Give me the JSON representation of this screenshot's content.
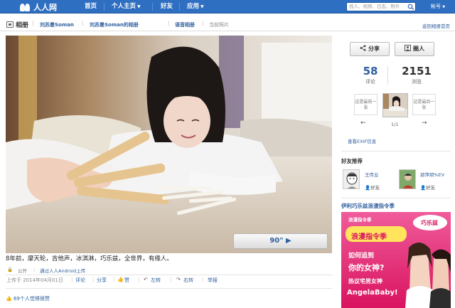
{
  "nav": {
    "logo": "人人网",
    "items": [
      {
        "label": "首页",
        "caret": false
      },
      {
        "label": "个人主页",
        "caret": true
      },
      {
        "label": "好友",
        "caret": false
      },
      {
        "label": "应用",
        "caret": true
      }
    ],
    "search_placeholder": "找人、视频、日志、照片",
    "account": "帐号"
  },
  "breadcrumb": {
    "title": "相册",
    "items": [
      "刘苏曼Soman",
      "刘苏曼Soman的相册",
      "语音相册",
      "当前照片"
    ],
    "back_link": "返回相册首页"
  },
  "photo": {
    "play_label": "90\" ▶"
  },
  "caption": "8年前，摩天轮，吉他声，冰淇淋，巧乐兹，全世界，有缘人。",
  "meta": {
    "visibility": "公开",
    "source": "通过人人Android上传"
  },
  "actions": {
    "uploaded": "上传于 2014年04月01日",
    "items": [
      "评论",
      "分享",
      "赞",
      "左转",
      "右转",
      "举报"
    ]
  },
  "likes": "69个人觉得很赞",
  "sidebar": {
    "share_label": "分享",
    "circle_label": "圈人",
    "stats": [
      {
        "value": "58",
        "label": "评论"
      },
      {
        "value": "2151",
        "label": "浏览"
      }
    ],
    "prev_text": "这是最前一张",
    "next_text": "这是最后一张",
    "pager": "1/1",
    "exif_link": "查看EXIF信息",
    "friends_title": "好友推荐",
    "friends": [
      {
        "name": "王传业",
        "add": "好友"
      },
      {
        "name": "郭萍玥%EV",
        "add": "好友"
      }
    ],
    "ad_title": "伊利巧乐兹浪漫指令季",
    "ad_texts": {
      "banner": "浪漫指令季",
      "brand": "巧乐兹",
      "line1": "如何追到",
      "line2": "你的女神?",
      "line3": "热议宅男女神",
      "line4": "AngelaBaby!"
    }
  },
  "colors": {
    "nav_bg": "#2f6fc1",
    "link": "#2f5f9e",
    "ad_bg": "#e8176f"
  }
}
